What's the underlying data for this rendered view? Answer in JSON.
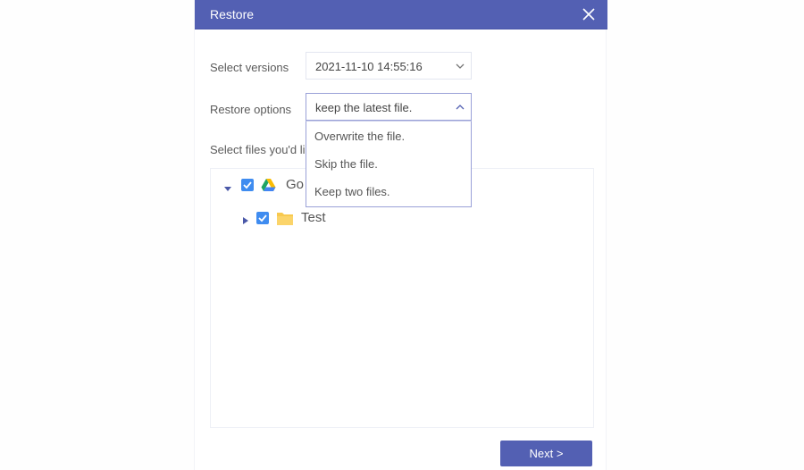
{
  "dialog": {
    "title": "Restore",
    "close_icon": "close-icon"
  },
  "form": {
    "versions_label": "Select versions",
    "versions_value": "2021-11-10 14:55:16",
    "restore_options_label": "Restore options",
    "restore_options_value": "keep the latest file.",
    "restore_options_list": [
      "Overwrite the file.",
      "Skip the file.",
      "Keep two files."
    ],
    "select_files_label": "Select files you'd li"
  },
  "tree": {
    "nodes": [
      {
        "label": "Go",
        "icon": "google-drive-icon",
        "checked": true,
        "expanded": true
      },
      {
        "label": "Test",
        "icon": "folder-icon",
        "checked": true,
        "expanded": false
      }
    ]
  },
  "footer": {
    "next_label": "Next >"
  },
  "colors": {
    "accent": "#5360b3",
    "checkbox": "#3f8cf0",
    "folder": "#f8c94f"
  }
}
